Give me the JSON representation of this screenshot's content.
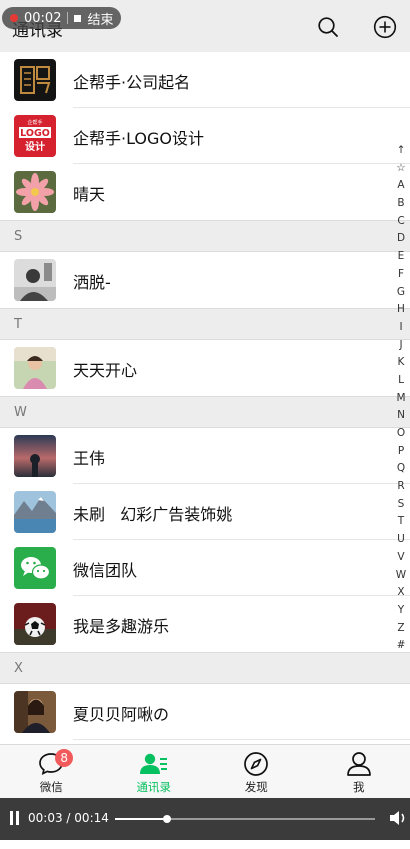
{
  "recording": {
    "time": "00:02",
    "stop_label": "结束"
  },
  "header": {
    "title": "通讯录"
  },
  "contacts_top": [
    {
      "name": "企帮手·公司起名"
    },
    {
      "name": "企帮手·LOGO设计"
    },
    {
      "name": "晴天"
    }
  ],
  "sections": [
    {
      "letter": "S",
      "contacts": [
        {
          "name": "洒脱-"
        }
      ]
    },
    {
      "letter": "T",
      "contacts": [
        {
          "name": "天天开心"
        }
      ]
    },
    {
      "letter": "W",
      "contacts": [
        {
          "name": "王伟"
        },
        {
          "name": "未刷   幻彩广告装饰姚"
        },
        {
          "name": "微信团队"
        },
        {
          "name": "我是多趣游乐"
        }
      ]
    },
    {
      "letter": "X",
      "contacts": [
        {
          "name": "夏贝贝阿啾の"
        }
      ]
    }
  ],
  "logo_text": {
    "line1": "LOGO",
    "line2": "设计",
    "small": "企帮手"
  },
  "index_letters": [
    "↑",
    "☆",
    "A",
    "B",
    "C",
    "D",
    "E",
    "F",
    "G",
    "H",
    "I",
    "J",
    "K",
    "L",
    "M",
    "N",
    "O",
    "P",
    "Q",
    "R",
    "S",
    "T",
    "U",
    "V",
    "W",
    "X",
    "Y",
    "Z",
    "#"
  ],
  "tabs": [
    {
      "label": "微信",
      "badge": "8"
    },
    {
      "label": "通讯录"
    },
    {
      "label": "发现"
    },
    {
      "label": "我"
    }
  ],
  "player": {
    "current": "00:03",
    "separator": "/",
    "total": "00:14",
    "progress": 0.2
  },
  "colors": {
    "accent": "#07c160",
    "badge": "#f25b5b",
    "section_bg": "#ededed"
  }
}
